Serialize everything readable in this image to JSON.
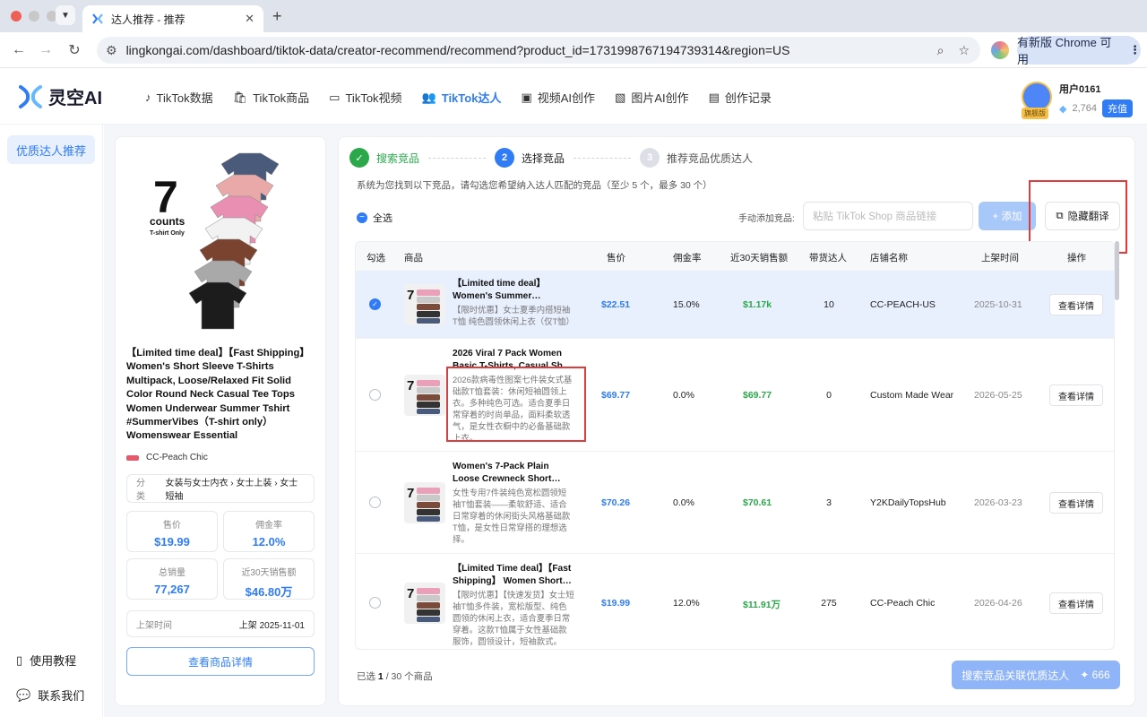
{
  "browser": {
    "tab_title": "达人推荐 - 推荐",
    "url": "lingkongai.com/dashboard/tiktok-data/creator-recommend/recommend?product_id=1731998767194739314&region=US",
    "update_label": "有新版 Chrome 可用"
  },
  "header": {
    "logo_text": "灵空AI",
    "nav": [
      {
        "label": "TikTok数据",
        "icon": "tiktok-icon",
        "active": false
      },
      {
        "label": "TikTok商品",
        "icon": "bag-icon",
        "active": false
      },
      {
        "label": "TikTok视频",
        "icon": "video-icon",
        "active": false
      },
      {
        "label": "TikTok达人",
        "icon": "users-icon",
        "active": true
      },
      {
        "label": "视频AI创作",
        "icon": "video-ai-icon",
        "active": false
      },
      {
        "label": "图片AI创作",
        "icon": "image-icon",
        "active": false
      },
      {
        "label": "创作记录",
        "icon": "folder-icon",
        "active": false
      }
    ],
    "user": {
      "name": "用户0161",
      "badge": "旗舰版",
      "points": "2,764",
      "recharge": "充值"
    }
  },
  "sidebar": {
    "active": "优质达人推荐",
    "tutorial": "使用教程",
    "contact": "联系我们"
  },
  "product": {
    "title": "【Limited time deal】【Fast Shipping】Women's Short Sleeve T-Shirts Multipack, Loose/Relaxed Fit Solid Color Round Neck Casual Tee Tops Women Underwear Summer Tshirt #SummerVibes（T-shirt only）Womenswear Essential",
    "image_text_top": "7",
    "image_text_mid": "counts",
    "image_text_bot": "T-shirt Only",
    "shop": "CC-Peach Chic",
    "category_label": "分类",
    "category": "女装与女士内衣 › 女士上装 › 女士短袖",
    "price_label": "售价",
    "price": "$19.99",
    "commission_label": "佣金率",
    "commission": "12.0%",
    "total_sales_label": "总销量",
    "total_sales": "77,267",
    "sales30_label": "近30天销售额",
    "sales30": "$46.80万",
    "listed_label": "上架时间",
    "listed": "上架 2025-11-01",
    "detail_btn": "查看商品详情"
  },
  "steps": [
    {
      "label": "搜索竞品",
      "state": "done",
      "num": "✓"
    },
    {
      "label": "选择竞品",
      "state": "current",
      "num": "2"
    },
    {
      "label": "推荐竞品优质达人",
      "state": "todo",
      "num": "3"
    }
  ],
  "hint": "系统为您找到以下竞品，请勾选您希望纳入达人匹配的竞品（至少 5 个，最多 30 个）",
  "toolbar": {
    "select_all": "全选",
    "manual_label": "手动添加竞品:",
    "link_placeholder": "粘贴 TikTok Shop 商品链接",
    "add_btn": "+ 添加",
    "hide_translate": "隐藏翻译"
  },
  "table": {
    "headers": [
      "勾选",
      "商品",
      "售价",
      "佣金率",
      "近30天销售额",
      "带货达人",
      "店铺名称",
      "上架时间",
      "操作"
    ],
    "rows": [
      {
        "checked": true,
        "name": "【Limited time deal】 Women's Summer…",
        "zh": "【限时优惠】女士夏季内搭短袖T恤 纯色圆领休闲上衣（仅T恤）",
        "price": "$22.51",
        "commission": "15.0%",
        "sales": "$1.17k",
        "creators": "10",
        "shop": "CC-PEACH-US",
        "date": "2025-10-31",
        "action": "查看详情"
      },
      {
        "checked": false,
        "name": "2026 Viral 7 Pack Women Basic T-Shirts, Casual Sh…",
        "zh": "2026款病毒性图案七件装女式基础款T恤套装：休闲短袖圆领上衣。多种纯色可选。适合夏季日常穿着的时尚单品，面料柔软透气，是女性衣橱中的必备基础款上衣。",
        "price": "$69.77",
        "commission": "0.0%",
        "sales": "$69.77",
        "creators": "0",
        "shop": "Custom Made Wear",
        "date": "2026-05-25",
        "action": "查看详情"
      },
      {
        "checked": false,
        "name": "Women's 7-Pack Plain Loose Crewneck Short…",
        "zh": "女性专用7件装纯色宽松圆领短袖T恤套装——柔软舒适、适合日常穿着的休闲街头风格基础款T恤，是女性日常穿搭的理想选择。",
        "price": "$70.26",
        "commission": "0.0%",
        "sales": "$70.61",
        "creators": "3",
        "shop": "Y2KDailyTopsHub",
        "date": "2026-03-23",
        "action": "查看详情"
      },
      {
        "checked": false,
        "name": "【Limited Time deal】【Fast Shipping】 Women Short…",
        "zh": "【限时优惠】【快速发货】女士短袖T恤多件装，宽松版型、纯色圆领的休闲上衣，适合夏季日常穿着。这款T恤属于女性基础款服饰，圆领设计，短袖款式。",
        "price": "$19.99",
        "commission": "12.0%",
        "sales": "$11.91万",
        "creators": "275",
        "shop": "CC-Peach Chic",
        "date": "2026-04-26",
        "action": "查看详情"
      }
    ]
  },
  "footer": {
    "selected_prefix": "已选",
    "selected_count": "1",
    "selected_total": "/ 30 个商品",
    "search_btn": "搜索竞品关联优质达人",
    "cost": "✦ 666"
  },
  "colors": {
    "accent": "#2f7cf6",
    "success": "#2aa84a",
    "highlight": "#e33b3b"
  }
}
